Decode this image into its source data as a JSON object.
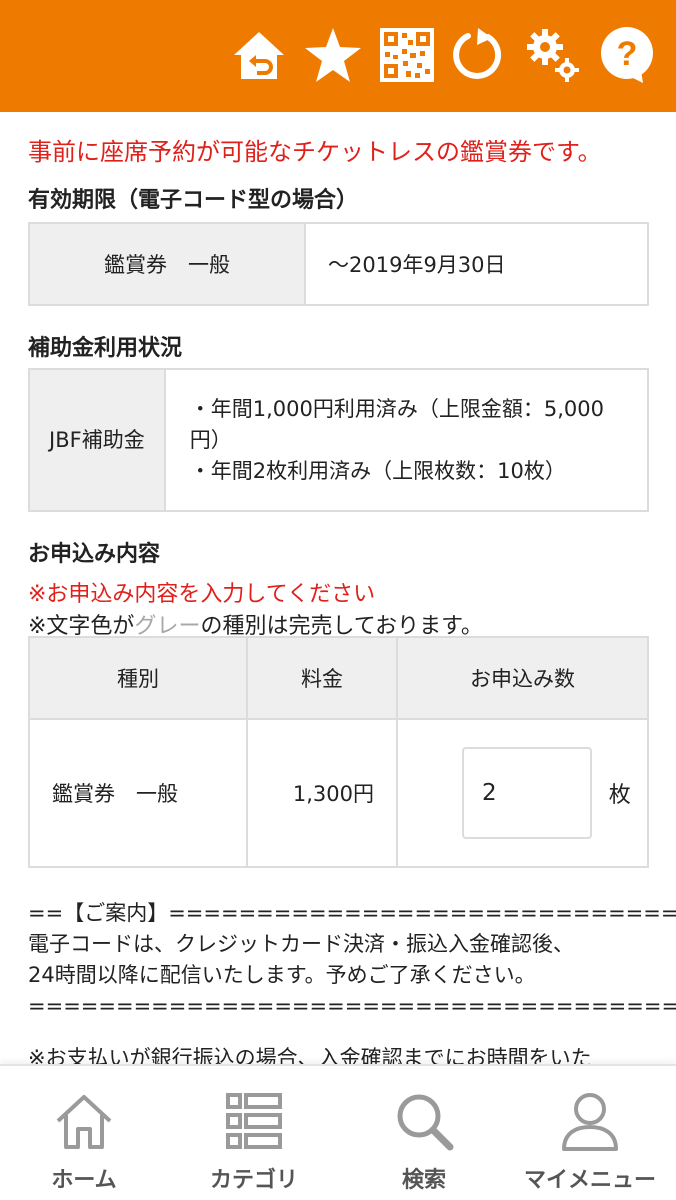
{
  "colors": {
    "header_bg": "#ee7a00",
    "accent_red": "#e0201a",
    "table_header_bg": "#efefef",
    "sold_out_gray": "#a8a8a8"
  },
  "header": {
    "icons": [
      "home-back-icon",
      "star-icon",
      "qr-code-icon",
      "reload-icon",
      "settings-icon",
      "help-icon"
    ]
  },
  "notice": "事前に座席予約が可能なチケットレスの鑑賞券です。",
  "validity": {
    "heading": "有効期限（電子コード型の場合）",
    "label": "鑑賞券　一般",
    "value": "〜2019年9月30日"
  },
  "subsidy": {
    "heading": "補助金利用状況",
    "label": "JBF補助金",
    "line1": "・年間1,000円利用済み（上限金額：5,000円）",
    "line2": "・年間2枚利用済み（上限枚数：10枚）"
  },
  "application": {
    "heading": "お申込み内容",
    "required_note": "※お申込み内容を入力してください",
    "gray_note_prefix": "※文字色が",
    "gray_note_gray": "グレー",
    "gray_note_suffix": "の種別は完売しております。",
    "columns": [
      "種別",
      "料金",
      "お申込み数"
    ],
    "rows": [
      {
        "type": "鑑賞券　一般",
        "price": "1,300円",
        "quantity": "2",
        "unit": "枚"
      }
    ]
  },
  "info": {
    "line1": "==【ご案内】======================================",
    "line2": "電子コードは、クレジットカード決済・振込入金確認後、",
    "line3": "24時間以降に配信いたします。予めご了承ください。",
    "line4": "==============================================",
    "line5": "※お支払いが銀行振込の場合、入金確認までにお時間をいた"
  },
  "bottom_nav": [
    {
      "label": "ホーム",
      "icon": "home-icon"
    },
    {
      "label": "カテゴリ",
      "icon": "category-list-icon"
    },
    {
      "label": "検索",
      "icon": "search-icon"
    },
    {
      "label": "マイメニュー",
      "icon": "user-icon"
    }
  ]
}
